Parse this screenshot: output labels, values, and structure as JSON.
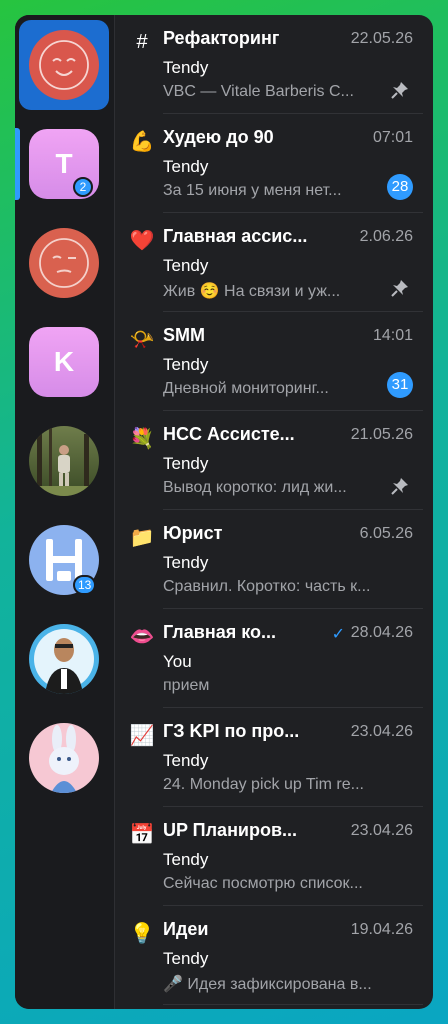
{
  "sidebar": {
    "items": [
      {
        "name": "Рефакторинг"
      },
      {
        "letter": "T",
        "badge": "2"
      },
      {
        "name": "Главная ассистент"
      },
      {
        "letter": "K"
      },
      {
        "name": "photo"
      },
      {
        "badge": "13"
      },
      {
        "name": "person"
      },
      {
        "name": "bunny"
      }
    ]
  },
  "chats": [
    {
      "icon": "#",
      "title": "Рефакторинг",
      "date": "22.05.26",
      "sender": "Tendy",
      "preview": "VBC — Vitale Barberis C...",
      "pinned": true
    },
    {
      "icon": "💪",
      "title": "Худею до 90",
      "date": "07:01",
      "sender": "Tendy",
      "preview": "За 15 июня у меня нет...",
      "badge": "28"
    },
    {
      "icon": "❤️",
      "title": "Главная ассис...",
      "date": "2.06.26",
      "sender": "Tendy",
      "preview": "Жив ☺️ На связи и уж...",
      "pinned": true
    },
    {
      "icon": "📯",
      "title": "SMM",
      "date": "14:01",
      "sender": "Tendy",
      "preview": "Дневной мониторинг...",
      "badge": "31"
    },
    {
      "icon": "💐",
      "title": "НСС Ассисте...",
      "date": "21.05.26",
      "sender": "Tendy",
      "preview": "Вывод коротко: лид жи...",
      "pinned": true
    },
    {
      "icon": "📁",
      "title": "Юрист",
      "date": "6.05.26",
      "sender": "Tendy",
      "preview": "Сравнил. Коротко: часть к..."
    },
    {
      "icon": "👄",
      "title": "Главная ко...",
      "date": "28.04.26",
      "sender": "You",
      "preview": "прием",
      "check": "✓"
    },
    {
      "icon": "📈",
      "title": "ГЗ KPI по про...",
      "date": "23.04.26",
      "sender": "Tendy",
      "preview": "24. Monday pick up Tim re..."
    },
    {
      "icon": "📅",
      "title": "UP Планиров...",
      "date": "23.04.26",
      "sender": "Tendy",
      "preview": "Сейчас посмотрю список..."
    },
    {
      "icon": "💡",
      "title": "Идеи",
      "date": "19.04.26",
      "sender": "Tendy",
      "preview": "🎤 Идея зафиксирована в..."
    }
  ],
  "colors": {
    "accent": "#2f9bff",
    "bg": "#1f2023",
    "sidebar": "#1a1b1e"
  }
}
